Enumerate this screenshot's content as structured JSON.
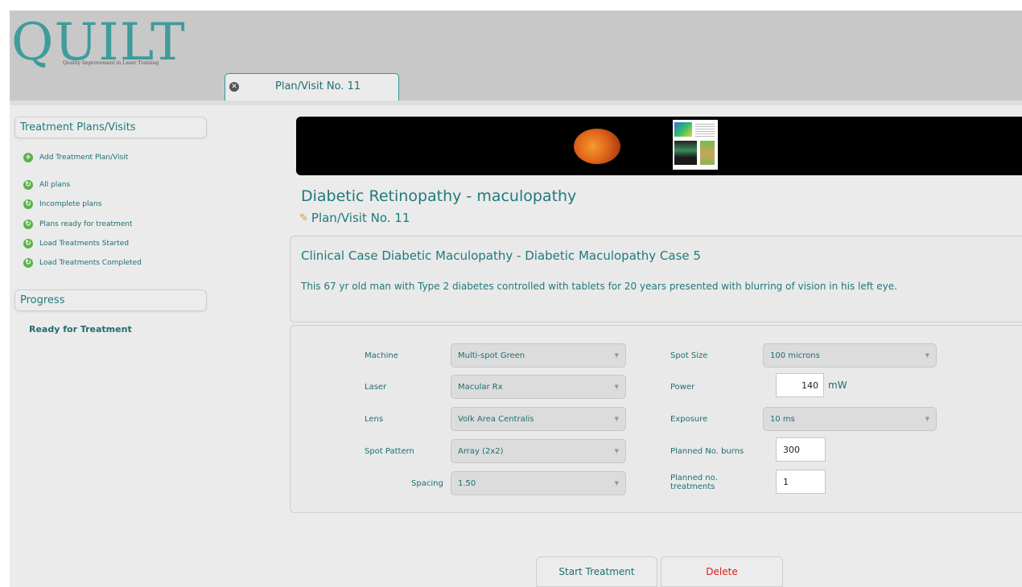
{
  "app": {
    "logo_text": "QUILT",
    "logo_subtitle": "Quality Improvement in Laser Training"
  },
  "tab": {
    "label": "Plan/Visit No. 11"
  },
  "sidebar": {
    "plans_header": "Treatment Plans/Visits",
    "add_item": "Add Treatment Plan/Visit",
    "items": [
      {
        "label": "All plans"
      },
      {
        "label": "Incomplete plans"
      },
      {
        "label": "Plans ready for treatment"
      },
      {
        "label": "Load Treatments Started"
      },
      {
        "label": "Load Treatments Completed"
      }
    ],
    "progress_header": "Progress",
    "progress_status": "Ready for Treatment"
  },
  "main": {
    "title": "Diabetic Retinopathy - maculopathy",
    "subtitle": "Plan/Visit No. 11",
    "case_title": "Clinical Case  Diabetic Maculopathy - Diabetic Maculopathy Case 5",
    "case_description": "This 67 yr old man with Type 2 diabetes controlled with tablets for 20 years presented with blurring of vision in his left eye."
  },
  "settings": {
    "machine": {
      "label": "Machine",
      "value": "Multi-spot Green"
    },
    "laser": {
      "label": "Laser",
      "value": "Macular Rx"
    },
    "lens": {
      "label": "Lens",
      "value": "Volk Area Centralis"
    },
    "spot_pattern": {
      "label": "Spot Pattern",
      "value": "Array (2x2)"
    },
    "spacing": {
      "label": "Spacing",
      "value": "1.50"
    },
    "spot_size": {
      "label": "Spot Size",
      "value": "100 microns"
    },
    "power": {
      "label": "Power",
      "value": "140",
      "unit": "mW"
    },
    "exposure": {
      "label": "Exposure",
      "value": "10 ms"
    },
    "planned_burns": {
      "label": "Planned No. burns",
      "value": "300"
    },
    "planned_treatments": {
      "label": "Planned no. treatments",
      "value": "1"
    }
  },
  "actions": {
    "start_label": "Start Treatment",
    "delete_label": "Delete"
  },
  "colors": {
    "accent": "#1f7a7c",
    "delete": "#d92020",
    "add_icon": "#5ab34a"
  },
  "icons": {
    "tab_close": "close-icon",
    "add": "plus-circle-icon",
    "list_item": "refresh-arrow-icon",
    "subtitle": "pencil-icon"
  }
}
